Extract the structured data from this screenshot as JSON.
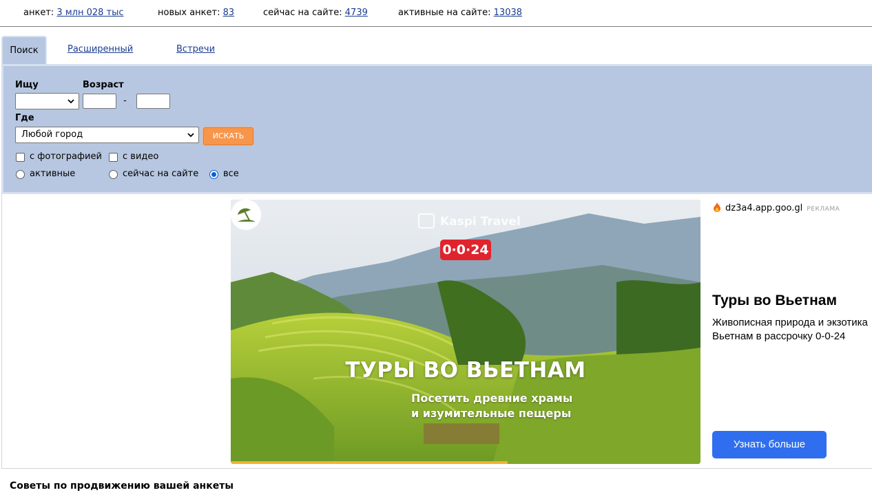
{
  "stats": [
    {
      "label": "анкет:",
      "value": "3 млн 028 тыс"
    },
    {
      "label": "новых анкет:",
      "value": "83"
    },
    {
      "label": "сейчас на сайте:",
      "value": "4739"
    },
    {
      "label": "активные на сайте:",
      "value": "13038"
    }
  ],
  "tabs": [
    {
      "label": "Поиск"
    },
    {
      "label": "Расширенный"
    },
    {
      "label": "Встречи"
    }
  ],
  "search": {
    "seek_label": "Ищу",
    "seek_value": "",
    "age_label": "Возраст",
    "age_from": "",
    "age_to": "",
    "age_dash": "-",
    "where_label": "Где",
    "city_value": "Любой город",
    "submit_label": "ИСКАТЬ",
    "checkboxes": [
      {
        "label": "с фотографией",
        "checked": false
      },
      {
        "label": "с видео",
        "checked": false
      }
    ],
    "radios": [
      {
        "label": "активные",
        "selected": false
      },
      {
        "label": "сейчас на сайте",
        "selected": false
      },
      {
        "label": "все",
        "selected": true
      }
    ]
  },
  "ad": {
    "video": {
      "brand": "Kaspi Travel",
      "badge": "0·0·24",
      "title": "ТУРЫ ВО ВЬЕТНАМ",
      "subtitle_line1": "Посетить древние храмы",
      "subtitle_line2": "и изумительные пещеры",
      "progress": 0.59
    },
    "domain": "dz3a4.app.goo.gl",
    "tag": "РЕКЛАМА",
    "headline": "Туры во Вьетнам",
    "text_line1": "Живописная природа и экзотика",
    "text_line2": "Вьетнам в рассрочку 0-0-24",
    "button_label": "Узнать больше"
  },
  "tips_title": "Советы по продвижению вашей анкеты",
  "colors": {
    "panel": "#b7c7e1",
    "search_button": "#f7964b",
    "ad_button": "#2f6fef",
    "badge": "#e0242d",
    "link": "#1a3d8f"
  }
}
